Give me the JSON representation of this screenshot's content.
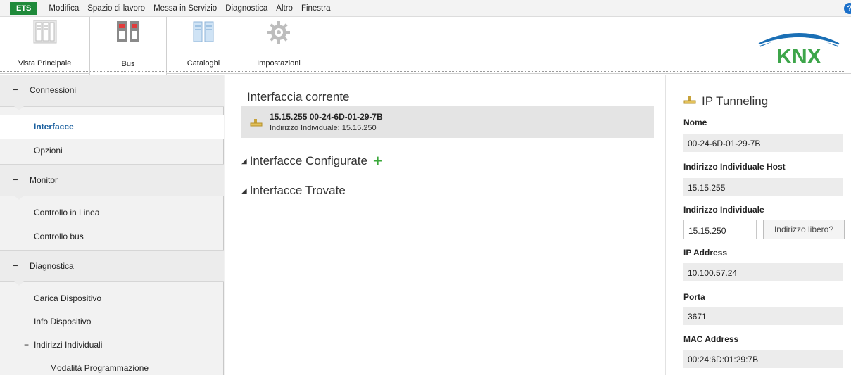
{
  "menubar": {
    "ets": "ETS",
    "items": [
      "Modifica",
      "Spazio di lavoro",
      "Messa in Servizio",
      "Diagnostica",
      "Altro",
      "Finestra"
    ],
    "help": "?"
  },
  "toolbar": {
    "tools": [
      {
        "label": "Vista Principale",
        "icon": "panels-icon"
      },
      {
        "label": "Bus",
        "icon": "bus-icon"
      },
      {
        "label": "Cataloghi",
        "icon": "catalog-icon"
      },
      {
        "label": "Impostazioni",
        "icon": "gear-icon"
      }
    ],
    "logo": "KNX"
  },
  "sidebar": {
    "sections": [
      {
        "label": "Connessioni",
        "sign": "−"
      },
      {
        "label": "Monitor",
        "sign": "−"
      },
      {
        "label": "Diagnostica",
        "sign": "−"
      }
    ],
    "items": {
      "interfacce": "Interfacce",
      "opzioni": "Opzioni",
      "controllo_in_linea": "Controllo in Linea",
      "controllo_bus": "Controllo bus",
      "carica_dispositivo": "Carica Dispositivo",
      "info_dispositivo": "Info Dispositivo",
      "indirizzi_individuali": "Indirizzi Individuali",
      "indirizzi_sign": "−",
      "modalita_programmazione": "Modalità Programmazione"
    },
    "selected": "Interfacce",
    "accent_color": "#1a5f9e"
  },
  "main": {
    "current_title": "Interfaccia corrente",
    "current_interface": {
      "name": "15.15.255 00-24-6D-01-29-7B",
      "detail": "Indirizzo Individuale: 15.15.250",
      "icon": "network-plug-icon"
    },
    "configured": "Interfacce Configurate",
    "found": "Interfacce Trovate",
    "add_icon": "+"
  },
  "details": {
    "title": "IP Tunneling",
    "nome_label": "Nome",
    "nome_value": "00-24-6D-01-29-7B",
    "host_label": "Indirizzo Individuale Host",
    "host_value": "15.15.255",
    "ind_label": "Indirizzo Individuale",
    "ind_value": "15.15.250",
    "free_button": "Indirizzo libero?",
    "ip_label": "IP Address",
    "ip_value": "10.100.57.24",
    "porta_label": "Porta",
    "porta_value": "3671",
    "mac_label": "MAC Address",
    "mac_value": "00:24:6D:01:29:7B"
  }
}
